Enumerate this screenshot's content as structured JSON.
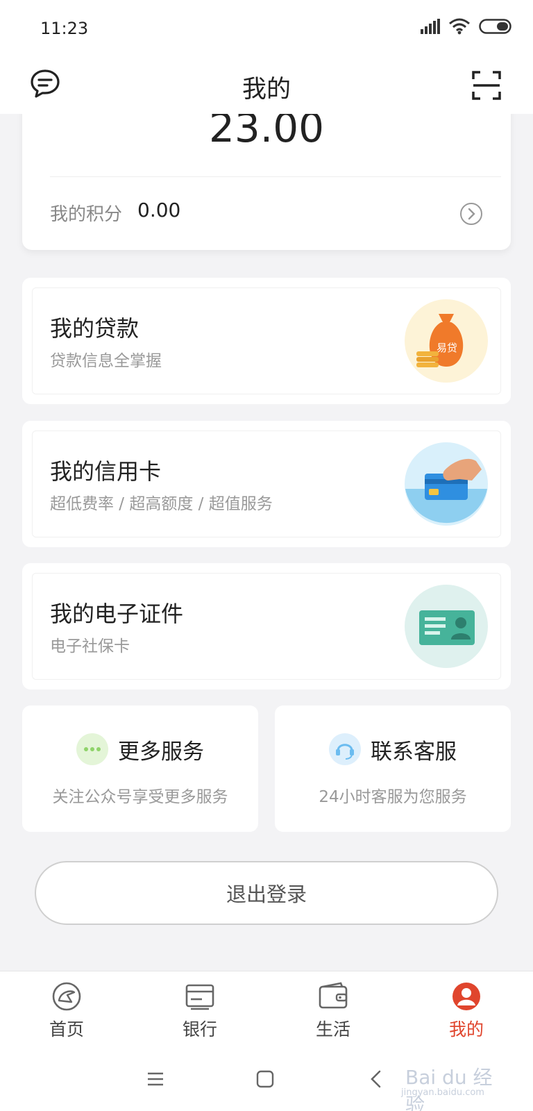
{
  "status_bar": {
    "time": "11:23"
  },
  "header": {
    "title": "我的",
    "message_icon": "chat-bubble-icon",
    "scan_icon": "scan-frame-icon"
  },
  "account": {
    "balance": "23.00",
    "points_label": "我的积分",
    "points_value": "0.00"
  },
  "features": [
    {
      "title": "我的贷款",
      "subtitle": "贷款信息全掌握",
      "illustration_text": "易贷",
      "icon": "money-bag-icon"
    },
    {
      "title": "我的信用卡",
      "subtitle": "超低费率 / 超高额度 / 超值服务",
      "icon": "credit-card-icon"
    },
    {
      "title": "我的电子证件",
      "subtitle": "电子社保卡",
      "icon": "id-card-icon"
    }
  ],
  "services": [
    {
      "title": "更多服务",
      "subtitle": "关注公众号享受更多服务",
      "icon": "more-dots-icon",
      "color": "#8fd36a"
    },
    {
      "title": "联系客服",
      "subtitle": "24小时客服为您服务",
      "icon": "headset-icon",
      "color": "#6bbcf0"
    }
  ],
  "logout_label": "退出登录",
  "tabs": [
    {
      "label": "首页",
      "icon": "home-icon",
      "active": false
    },
    {
      "label": "银行",
      "icon": "bank-card-icon",
      "active": false
    },
    {
      "label": "生活",
      "icon": "wallet-icon",
      "active": false
    },
    {
      "label": "我的",
      "icon": "profile-icon",
      "active": true
    }
  ],
  "colors": {
    "accent": "#e0452d",
    "background": "#f3f3f5"
  },
  "watermark": {
    "brand": "Bai du 经验",
    "domain": "jingyan.baidu.com"
  }
}
